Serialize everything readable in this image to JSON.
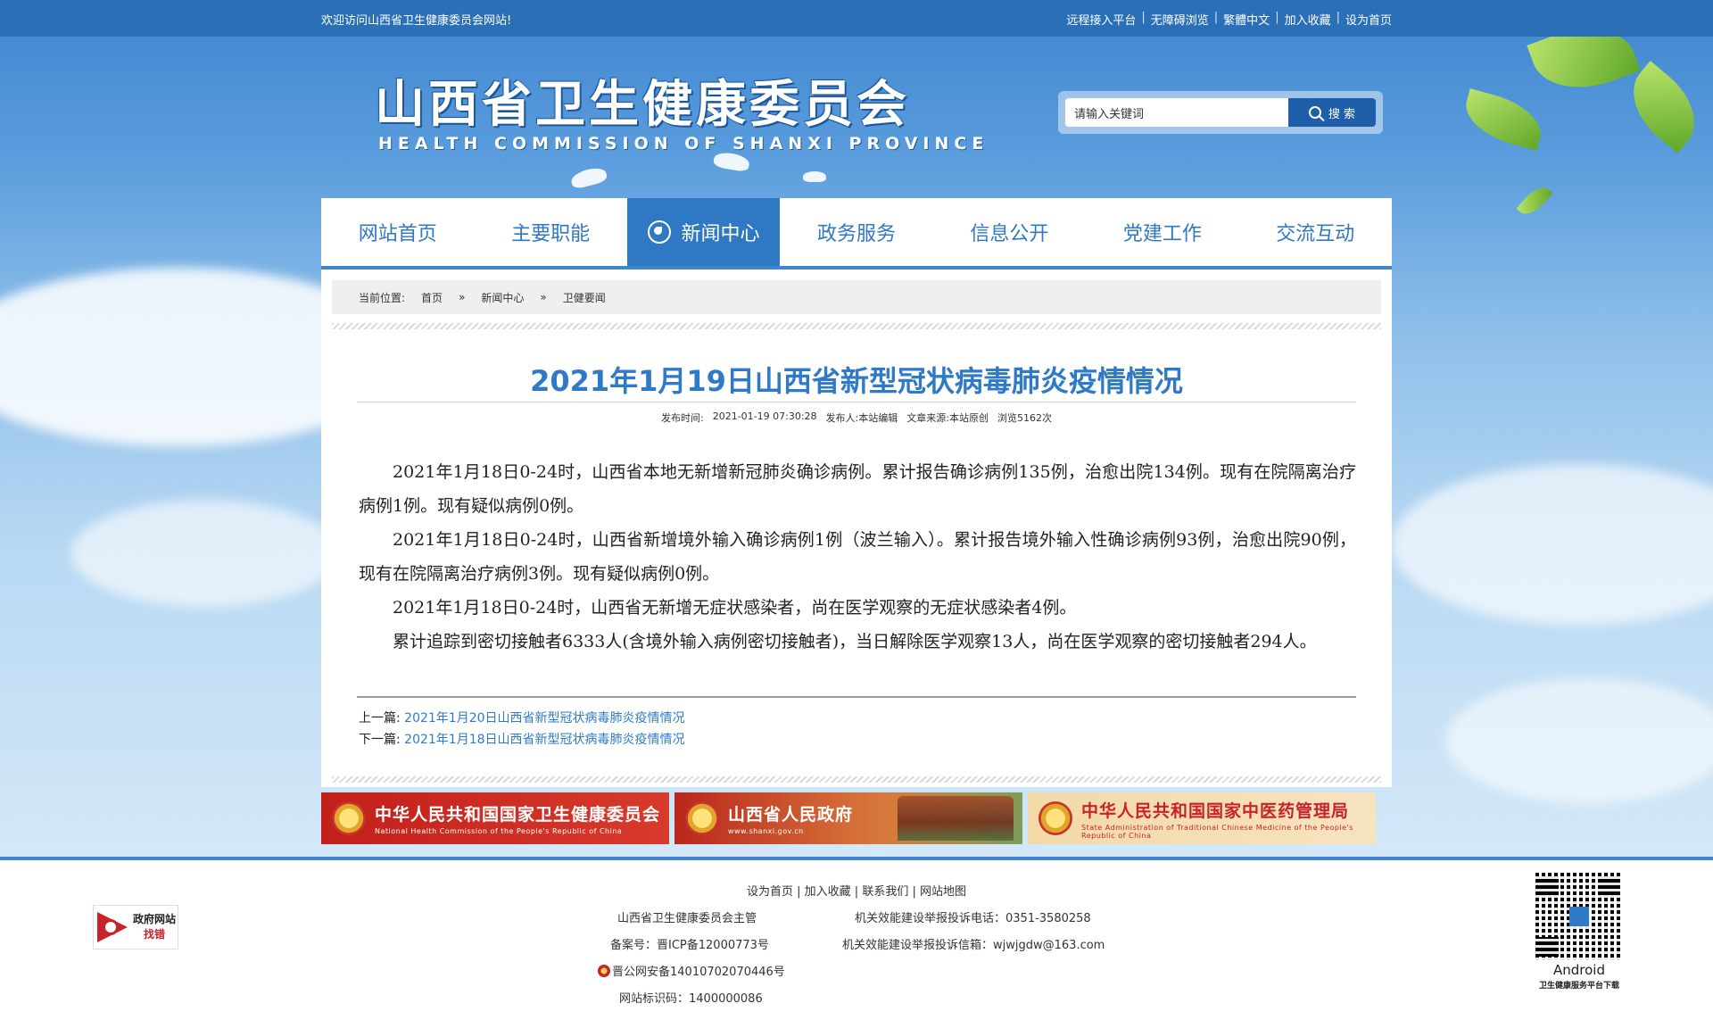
{
  "topbar": {
    "welcome": "欢迎访问山西省卫生健康委员会网站!",
    "links": [
      "远程接入平台",
      "无障碍浏览",
      "繁體中文",
      "加入收藏",
      "设为首页"
    ]
  },
  "header": {
    "title": "山西省卫生健康委员会",
    "subtitle": "HEALTH COMMISSION OF SHANXI PROVINCE",
    "search": {
      "placeholder": "请输入关键词",
      "value": "请输入关键词",
      "button": "搜 索"
    }
  },
  "nav": {
    "items": [
      "网站首页",
      "主要职能",
      "新闻中心",
      "政务服务",
      "信息公开",
      "党建工作",
      "交流互动"
    ],
    "active_index": 2
  },
  "breadcrumb": {
    "label": "当前位置:",
    "items": [
      "首页",
      "新闻中心",
      "卫健要闻"
    ],
    "separator": "»"
  },
  "article": {
    "title": "2021年1月19日山西省新型冠状病毒肺炎疫情情况",
    "meta": {
      "time_label": "发布时间:",
      "time": "2021-01-19 07:30:28",
      "publisher": "发布人:本站编辑",
      "source": "文章来源:本站原创",
      "views": "浏览5162次"
    },
    "paragraphs": [
      "2021年1月18日0-24时，山西省本地无新增新冠肺炎确诊病例。累计报告确诊病例135例，治愈出院134例。现有在院隔离治疗病例1例。现有疑似病例0例。",
      "2021年1月18日0-24时，山西省新增境外输入确诊病例1例（波兰输入）。累计报告境外输入性确诊病例93例，治愈出院90例，现有在院隔离治疗病例3例。现有疑似病例0例。",
      "2021年1月18日0-24时，山西省无新增无症状感染者，尚在医学观察的无症状感染者4例。",
      "累计追踪到密切接触者6333人(含境外输入病例密切接触者)，当日解除医学观察13人，尚在医学观察的密切接触者294人。"
    ],
    "prev_label": "上一篇:",
    "prev_title": "2021年1月20日山西省新型冠状病毒肺炎疫情情况",
    "next_label": "下一篇:",
    "next_title": "2021年1月18日山西省新型冠状病毒肺炎疫情情况"
  },
  "banners": [
    {
      "title": "中华人民共和国国家卫生健康委员会",
      "subtitle": "National Health Commission of the People's Republic of China"
    },
    {
      "title": "山西省人民政府",
      "subtitle": "www.shanxi.gov.cn"
    },
    {
      "title": "中华人民共和国国家中医药管理局",
      "subtitle": "State Administration of Traditional Chinese Medicine of the People's Republic of China"
    }
  ],
  "footer": {
    "links": [
      "设为首页",
      "加入收藏",
      "联系我们",
      "网站地图"
    ],
    "sponsor": "山西省卫生健康委员会主管",
    "icp": "备案号：晋ICP备12000773号",
    "police": "晋公网安备14010702070446号",
    "site_code": "网站标识码：1400000086",
    "phone": "机关效能建设举报投诉电话：0351-3580258",
    "email": "机关效能建设举报投诉信箱：wjwjgdw@163.com",
    "gov_badge_line1": "政府网站",
    "gov_badge_line2": "找错",
    "qr_label": "Android",
    "qr_sub": "卫生健康服务平台下载"
  },
  "colors": {
    "accent": "#2f78c4",
    "topbar": "#2b6fb6",
    "banner_red": "#c21f1a"
  }
}
